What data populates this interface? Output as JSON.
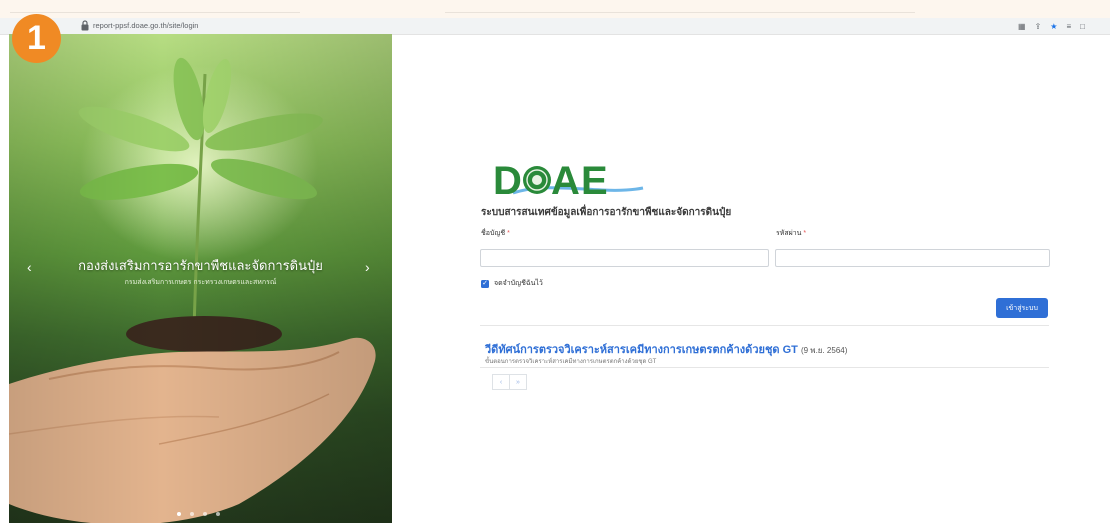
{
  "badge": {
    "number": "1",
    "color": "#f08a24"
  },
  "browser": {
    "url": "report-ppsf.doae.go.th/site/login",
    "icons": [
      "translate-icon",
      "share-icon",
      "bookmark-star-icon",
      "reading-list-icon",
      "window-icon"
    ]
  },
  "carousel": {
    "title": "กองส่งเสริมการอารักขาพืชและจัดการดินปุ๋ย",
    "subtitle": "กรมส่งเสริมการเกษตร กระทรวงเกษตรและสหกรณ์",
    "prev_icon": "‹",
    "next_icon": "›",
    "slide_count": 4,
    "active_slide": 1
  },
  "logo": {
    "text": "DOAE",
    "green": "#2a8a3a",
    "blue": "#1f5fae"
  },
  "form": {
    "system_title": "ระบบสารสนเทศข้อมูลเพื่อการอารักขาพืชและจัดการดินปุ๋ย",
    "username_label": "ชื่อบัญชี",
    "password_label": "รหัสผ่าน",
    "required_mark": "*",
    "username_value": "",
    "password_value": "",
    "remember_label": "จดจำบัญชีฉันไว้",
    "remember_checked": true,
    "login_button": "เข้าสู่ระบบ",
    "accent": "#2f6fd6"
  },
  "news": {
    "title": "วีดีทัศน์การตรวจวิเคราะห์สารเคมีทางการเกษตรตกค้างด้วยชุด GT",
    "date": "(9 พ.ย. 2564)",
    "description": "ขั้นตอนการตรวจวิเคราะห์สารเคมีทางการเกษตรตกค้างด้วยชุด GT",
    "pager_prev": "‹",
    "pager_next": "»"
  }
}
